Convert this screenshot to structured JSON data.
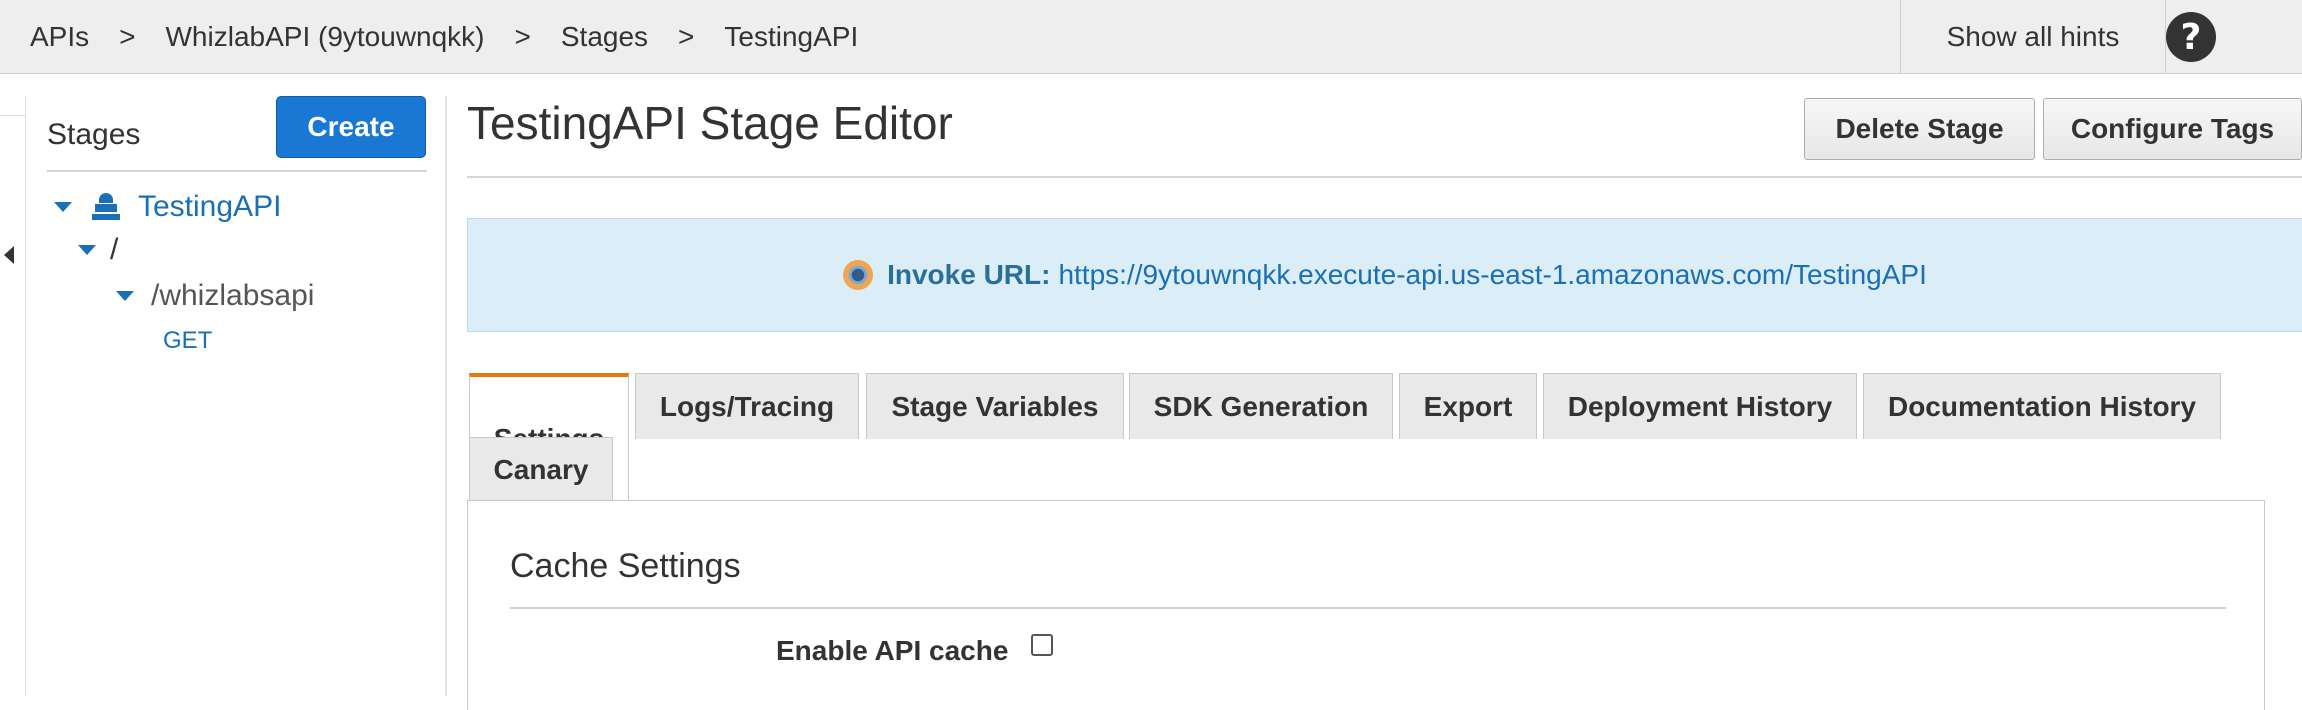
{
  "breadcrumb": {
    "items": [
      "APIs",
      "WhizlabAPI (9ytouwnqkk)",
      "Stages",
      "TestingAPI"
    ],
    "separator": ">"
  },
  "topbar": {
    "hints_label": "Show all hints",
    "help_glyph": "?"
  },
  "stages_pane": {
    "title": "Stages",
    "create_label": "Create",
    "tree": {
      "stage": "TestingAPI",
      "root": "/",
      "resource": "/whizlabsapi",
      "method": "GET"
    }
  },
  "editor": {
    "title": "TestingAPI Stage Editor",
    "delete_label": "Delete Stage",
    "tags_label": "Configure Tags",
    "invoke_label": "Invoke URL:",
    "invoke_url": "https://9ytouwnqkk.execute-api.us-east-1.amazonaws.com/TestingAPI",
    "tabs": [
      {
        "label": "Settings",
        "active": true
      },
      {
        "label": "Logs/Tracing",
        "active": false
      },
      {
        "label": "Stage Variables",
        "active": false
      },
      {
        "label": "SDK Generation",
        "active": false
      },
      {
        "label": "Export",
        "active": false
      },
      {
        "label": "Deployment History",
        "active": false
      },
      {
        "label": "Documentation History",
        "active": false
      },
      {
        "label": "Canary",
        "active": false
      }
    ],
    "cache": {
      "title": "Cache Settings",
      "enable_label": "Enable API cache",
      "enabled": false
    }
  },
  "colors": {
    "accent_blue": "#1978d4",
    "link_blue": "#1a6fb5",
    "active_tab_orange": "#e47911",
    "invoke_bg": "#dbedf7"
  },
  "icons": {
    "help": "question-circle-icon",
    "collapse": "caret-left-icon",
    "stage": "stage-cruise-icon",
    "invoke": "radio-dot-icon",
    "tree_caret": "caret-down-icon"
  }
}
